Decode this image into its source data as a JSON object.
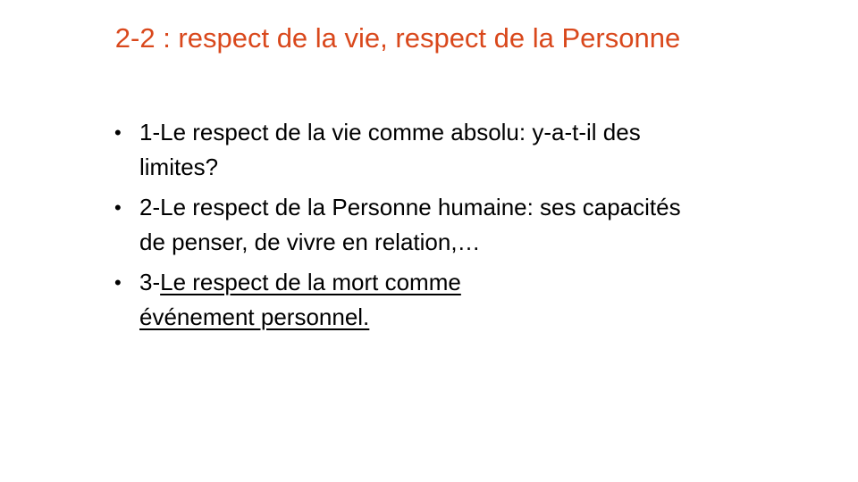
{
  "slide": {
    "title": "2-2 : respect de la vie, respect de la Personne",
    "bullet_symbol": "•",
    "bullets": [
      {
        "text": "1-Le respect de la vie comme absolu: y-a-t-il des limites?"
      },
      {
        "text": "2-Le respect de la Personne humaine: ses capacités de penser, de vivre en relation,…"
      },
      {
        "prefix": "3-",
        "underlined_text": "Le respect de la mort comme événement personnel."
      }
    ]
  },
  "colors": {
    "title": "#d9481c",
    "body_text": "#000000",
    "background": "#ffffff"
  }
}
